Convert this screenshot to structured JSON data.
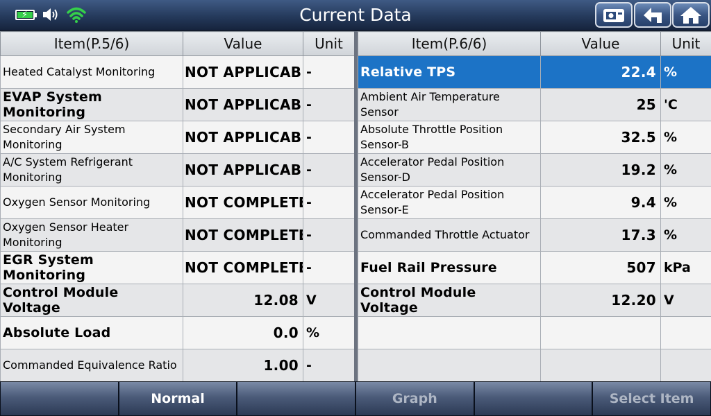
{
  "window": {
    "title": "Current Data"
  },
  "status_icons": [
    "battery-charging-icon",
    "speaker-icon",
    "wifi-icon"
  ],
  "top_buttons": [
    "screenshot-icon",
    "back-up-icon",
    "home-icon"
  ],
  "left_table": {
    "headers": {
      "item": "Item(P.5/6)",
      "value": "Value",
      "unit": "Unit"
    },
    "rows": [
      {
        "item": "Heated Catalyst Monitoring",
        "value": "NOT APPLICABLE",
        "unit": "-"
      },
      {
        "item": "EVAP System Monitoring",
        "value": "NOT APPLICABLE",
        "unit": "-"
      },
      {
        "item": "Secondary Air System Monitoring",
        "value": "NOT APPLICABLE",
        "unit": "-"
      },
      {
        "item": "A/C System Refrigerant Monitoring",
        "value": "NOT APPLICABLE",
        "unit": "-"
      },
      {
        "item": "Oxygen Sensor Monitoring",
        "value": "NOT COMPLETED",
        "unit": "-"
      },
      {
        "item": "Oxygen Sensor Heater Monitoring",
        "value": "NOT COMPLETED",
        "unit": "-"
      },
      {
        "item": "EGR System Monitoring",
        "value": "NOT COMPLETED",
        "unit": "-"
      },
      {
        "item": "Control Module Voltage",
        "value": "12.08",
        "unit": "V"
      },
      {
        "item": "Absolute Load",
        "value": "0.0",
        "unit": "%"
      },
      {
        "item": "Commanded Equivalence Ratio",
        "value": "1.00",
        "unit": "-"
      }
    ]
  },
  "right_table": {
    "headers": {
      "item": "Item(P.6/6)",
      "value": "Value",
      "unit": "Unit"
    },
    "rows": [
      {
        "item": "Relative TPS",
        "value": "22.4",
        "unit": "%"
      },
      {
        "item": "Ambient Air Temperature Sensor",
        "value": "25",
        "unit": "'C"
      },
      {
        "item": "Absolute Throttle Position Sensor-B",
        "value": "32.5",
        "unit": "%"
      },
      {
        "item": "Accelerator Pedal Position Sensor-D",
        "value": "19.2",
        "unit": "%"
      },
      {
        "item": "Accelerator Pedal Position Sensor-E",
        "value": "9.4",
        "unit": "%"
      },
      {
        "item": "Commanded Throttle Actuator",
        "value": "17.3",
        "unit": "%"
      },
      {
        "item": "Fuel Rail Pressure",
        "value": "507",
        "unit": "kPa"
      },
      {
        "item": "Control Module Voltage",
        "value": "12.20",
        "unit": "V"
      }
    ],
    "selected_row": "Relative TPS"
  },
  "bottom_bar": {
    "buttons": [
      "",
      "Normal",
      "",
      "Graph",
      "",
      "Select Item"
    ]
  },
  "colors": {
    "selection": "#1c73c6",
    "titlebar": "#253a5c",
    "battery_fill": "#35d04a",
    "wifi": "#35d04a"
  }
}
